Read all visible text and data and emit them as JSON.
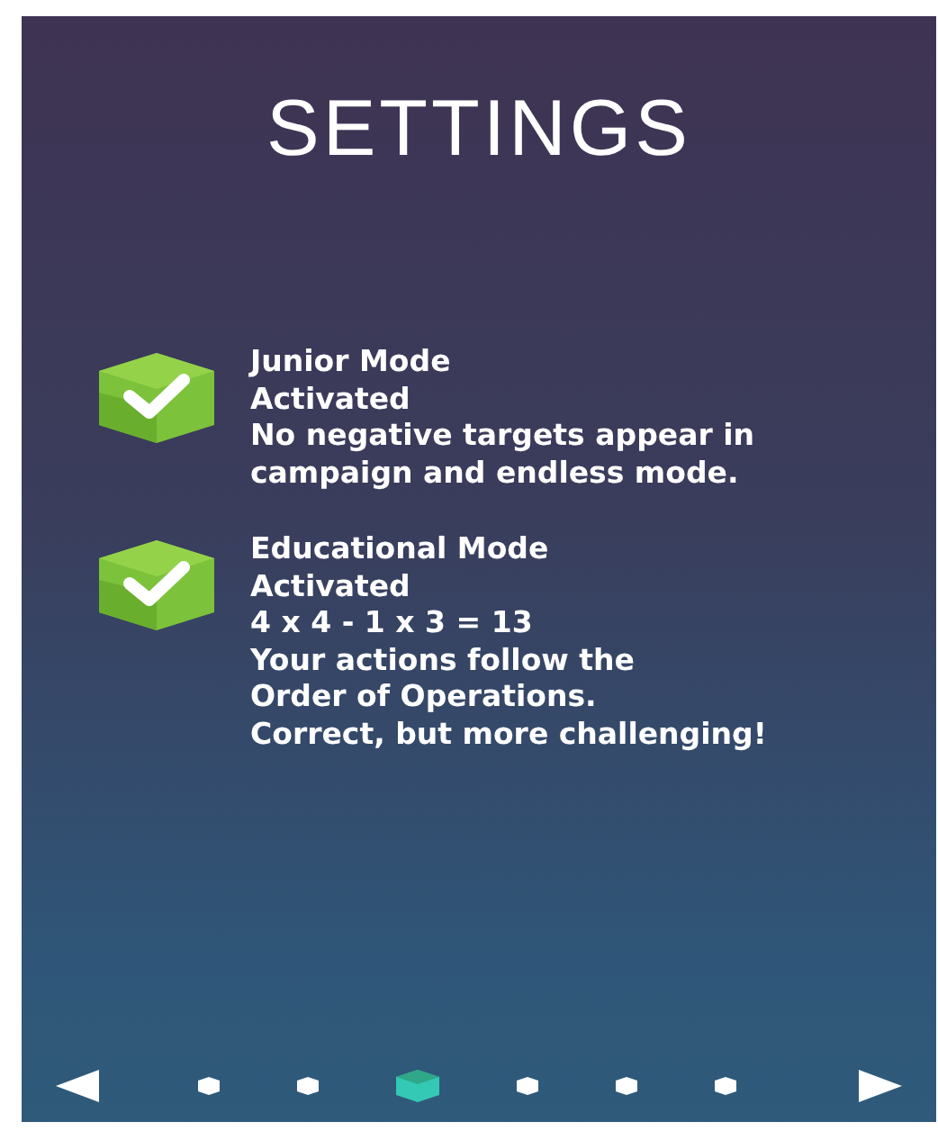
{
  "title": "SETTINGS",
  "options": [
    {
      "checked": true,
      "title": "Junior Mode",
      "status": "Activated",
      "description_lines": [
        "No negative targets appear in",
        "campaign and endless mode."
      ]
    },
    {
      "checked": true,
      "title": "Educational Mode",
      "status": "Activated",
      "description_lines": [
        "4 x 4 - 1 x 3 = 13",
        "Your actions follow the",
        "Order of Operations.",
        "Correct, but more challenging!"
      ]
    }
  ],
  "pages": [
    {
      "selected": false
    },
    {
      "selected": false
    },
    {
      "selected": true
    },
    {
      "selected": false
    },
    {
      "selected": false
    },
    {
      "selected": false
    }
  ]
}
